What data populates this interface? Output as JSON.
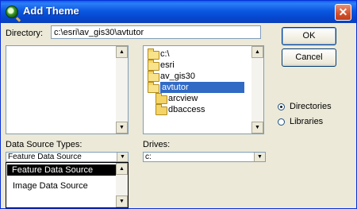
{
  "window": {
    "title": "Add Theme",
    "close_glyph": "✕"
  },
  "directory": {
    "label": "Directory:",
    "value": "c:\\esri\\av_gis30\\avtutor"
  },
  "buttons": {
    "ok": "OK",
    "cancel": "Cancel"
  },
  "tree": {
    "items": [
      {
        "label": "c:\\",
        "icon": "open-folder-icon"
      },
      {
        "label": "esri",
        "icon": "open-folder-icon"
      },
      {
        "label": "av_gis30",
        "icon": "open-folder-icon"
      },
      {
        "label": "avtutor",
        "icon": "open-folder-icon",
        "selected": true
      },
      {
        "label": "arcview",
        "icon": "folder-icon"
      },
      {
        "label": "dbaccess",
        "icon": "folder-icon"
      }
    ]
  },
  "source_types": {
    "label": "Data Source Types:",
    "value": "Feature Data Source",
    "options": [
      "Feature Data Source",
      "Image Data Source"
    ]
  },
  "drives": {
    "label": "Drives:",
    "value": "c:"
  },
  "mode": {
    "directories": "Directories",
    "libraries": "Libraries",
    "selected": "Directories"
  },
  "colors": {
    "selection": "#316ac5",
    "titlebar": "#0a58e0"
  }
}
